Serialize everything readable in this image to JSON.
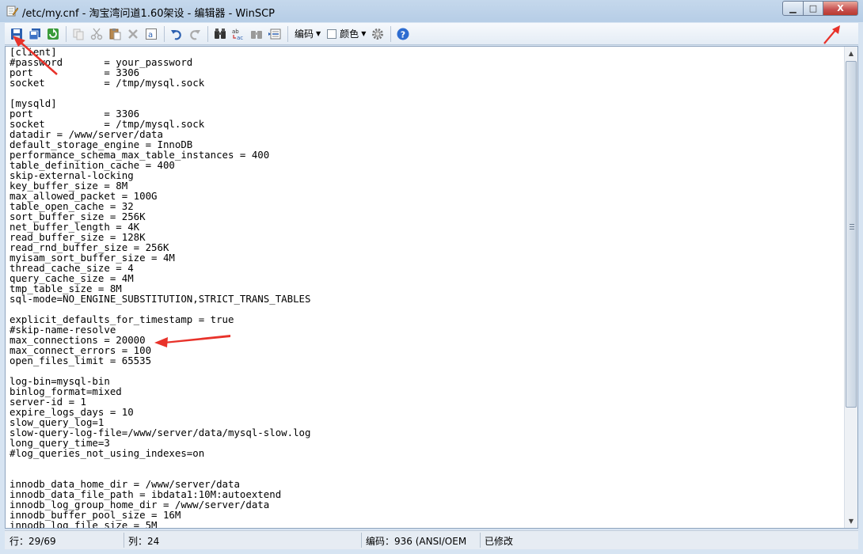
{
  "window": {
    "title": "/etc/my.cnf - 淘宝湾问道1.60架设 - 编辑器 - WinSCP",
    "buttons": {
      "minimize": "▁",
      "maximize": "□",
      "close": "X"
    }
  },
  "toolbar": {
    "encoding_label": "编码",
    "color_label": "颜色",
    "icons": [
      "save-icon",
      "save-all-icon",
      "reload-icon",
      "copy-icon",
      "cut-icon",
      "paste-icon",
      "delete-icon",
      "select-all-icon",
      "undo-icon",
      "redo-icon",
      "find-icon",
      "replace-icon",
      "find-next-icon",
      "goto-line-icon",
      "settings-icon",
      "help-icon"
    ]
  },
  "editor": {
    "lines": [
      "[client]",
      "#password       = your_password",
      "port            = 3306",
      "socket          = /tmp/mysql.sock",
      "",
      "[mysqld]",
      "port            = 3306",
      "socket          = /tmp/mysql.sock",
      "datadir = /www/server/data",
      "default_storage_engine = InnoDB",
      "performance_schema_max_table_instances = 400",
      "table_definition_cache = 400",
      "skip-external-locking",
      "key_buffer_size = 8M",
      "max_allowed_packet = 100G",
      "table_open_cache = 32",
      "sort_buffer_size = 256K",
      "net_buffer_length = 4K",
      "read_buffer_size = 128K",
      "read_rnd_buffer_size = 256K",
      "myisam_sort_buffer_size = 4M",
      "thread_cache_size = 4",
      "query_cache_size = 4M",
      "tmp_table_size = 8M",
      "sql-mode=NO_ENGINE_SUBSTITUTION,STRICT_TRANS_TABLES",
      "",
      "explicit_defaults_for_timestamp = true",
      "#skip-name-resolve",
      "max_connections = 20000",
      "max_connect_errors = 100",
      "open_files_limit = 65535",
      "",
      "log-bin=mysql-bin",
      "binlog_format=mixed",
      "server-id = 1",
      "expire_logs_days = 10",
      "slow_query_log=1",
      "slow-query-log-file=/www/server/data/mysql-slow.log",
      "long_query_time=3",
      "#log_queries_not_using_indexes=on",
      "",
      "",
      "innodb_data_home_dir = /www/server/data",
      "innodb_data_file_path = ibdata1:10M:autoextend",
      "innodb_log_group_home_dir = /www/server/data",
      "innodb_buffer_pool_size = 16M",
      "innodb_log_file_size = 5M"
    ]
  },
  "statusbar": {
    "row": "行：29/69",
    "col": "列：24",
    "encoding": "编码：936   (ANSI/OEM",
    "modified": "已修改"
  },
  "colors": {
    "annotation_arrow": "#e8322a",
    "titlebar": "#c5d8ec"
  }
}
